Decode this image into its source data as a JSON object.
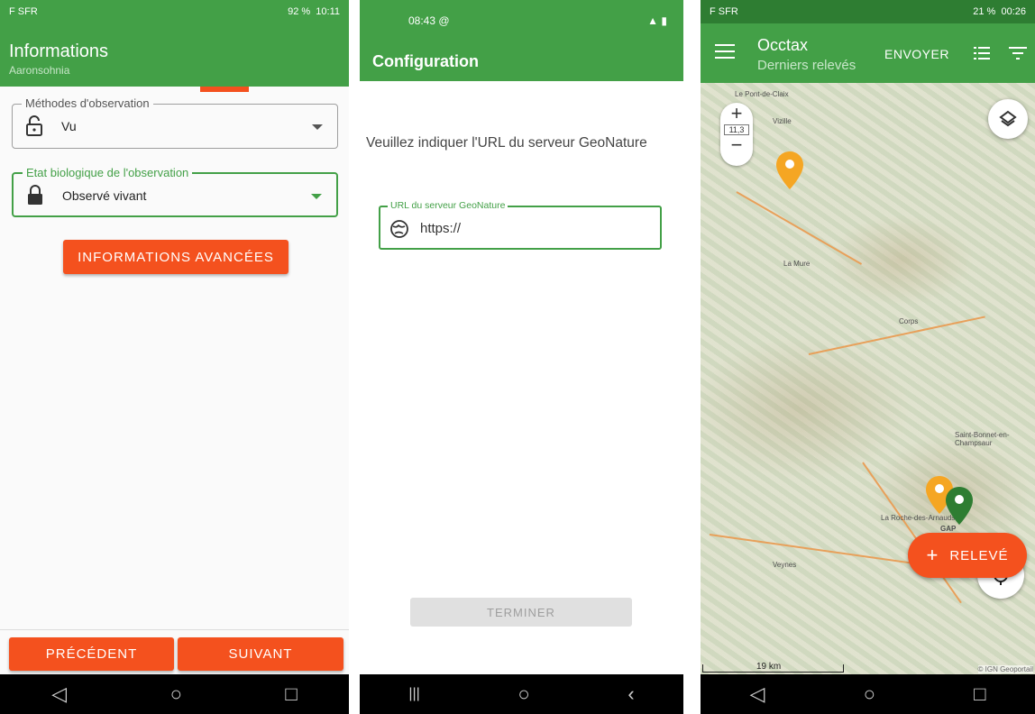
{
  "screen1": {
    "status": {
      "carrier": "F SFR",
      "right": "92 %",
      "time": "10:11"
    },
    "title": "Informations",
    "subtitle": "Aaronsohnia",
    "fields": [
      {
        "label": "Méthodes d'observation",
        "value": "Vu"
      },
      {
        "label": "Etat biologique de l'observation",
        "value": "Observé vivant"
      }
    ],
    "advanced_button": "INFORMATIONS AVANCÉES",
    "prev_button": "PRÉCÉDENT",
    "next_button": "SUIVANT"
  },
  "screen2": {
    "status": {
      "time": "08:43 @"
    },
    "title": "Configuration",
    "prompt": "Veuillez indiquer l'URL du serveur GeoNature",
    "url_field": {
      "label": "URL du serveur GeoNature",
      "value": "https://"
    },
    "finish_button": "TERMINER"
  },
  "screen3": {
    "status": {
      "carrier": "F SFR",
      "right": "21 %",
      "time": "00:26"
    },
    "title": "Occtax",
    "subtitle": "Derniers relevés",
    "send_button": "ENVOYER",
    "zoom": {
      "plus": "+",
      "level": "11,3",
      "minus": "−"
    },
    "fab_label": "RELEVÉ",
    "scale_label": "19 km",
    "attribution": "© IGN Geoportail",
    "places": [
      "Le Pont-de-Claix",
      "Vizille",
      "La Mure",
      "Corps",
      "Saint-Bonnet-en-Champsaur",
      "GAP",
      "La Roche-des-Arnauds",
      "Veynes"
    ]
  },
  "colors": {
    "green": "#43a047",
    "orange": "#f4511e",
    "pin_orange": "#f5a623",
    "pin_green": "#2e7d32"
  }
}
